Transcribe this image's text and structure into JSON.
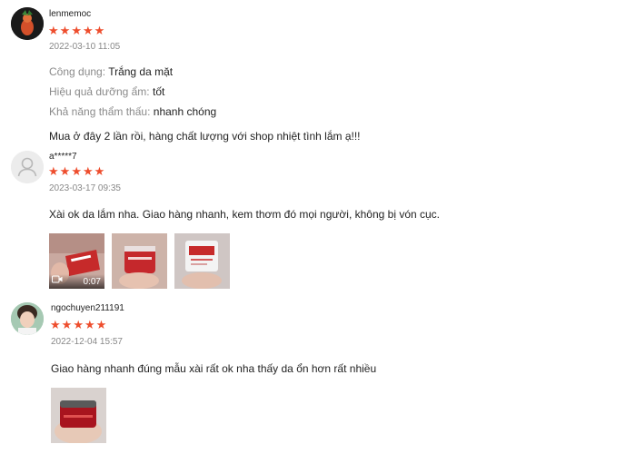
{
  "reviews": [
    {
      "username": "lenmemoc",
      "avatar": "profile-photo",
      "rating": 5,
      "date": "2022-03-10 11:05",
      "attributes": [
        {
          "label": "Công dụng:",
          "value": "Trắng da mặt"
        },
        {
          "label": "Hiệu quả dưỡng ẩm:",
          "value": "tốt"
        },
        {
          "label": "Khả năng thẩm thấu:",
          "value": "nhanh chóng"
        }
      ],
      "comment": "Mua ở đây 2 lần rồi, hàng chất lượng với shop nhiệt tình lắm ạ!!!"
    },
    {
      "username": "a*****7",
      "avatar": "default-user-icon",
      "rating": 5,
      "date": "2023-03-17 09:35",
      "comment": "Xài ok da lắm nha. Giao hàng nhanh, kem thơm đó mọi người, không bị vón cục.",
      "media": [
        {
          "type": "video",
          "duration": "0:07"
        },
        {
          "type": "image"
        },
        {
          "type": "image"
        }
      ]
    },
    {
      "username": "ngochuyen211191",
      "avatar": "profile-photo",
      "rating": 5,
      "date": "2022-12-04 15:57",
      "comment": "Giao hàng nhanh đúng mẫu xài rất ok nha thấy da ổn hơn rất nhiều",
      "media": [
        {
          "type": "image"
        }
      ]
    }
  ],
  "colors": {
    "star": "#ee4d2d",
    "meta_text": "#888888",
    "label_text": "#8a8a8a",
    "body_text": "#222222"
  },
  "icons": {
    "star": "★",
    "video": "camera-icon"
  }
}
